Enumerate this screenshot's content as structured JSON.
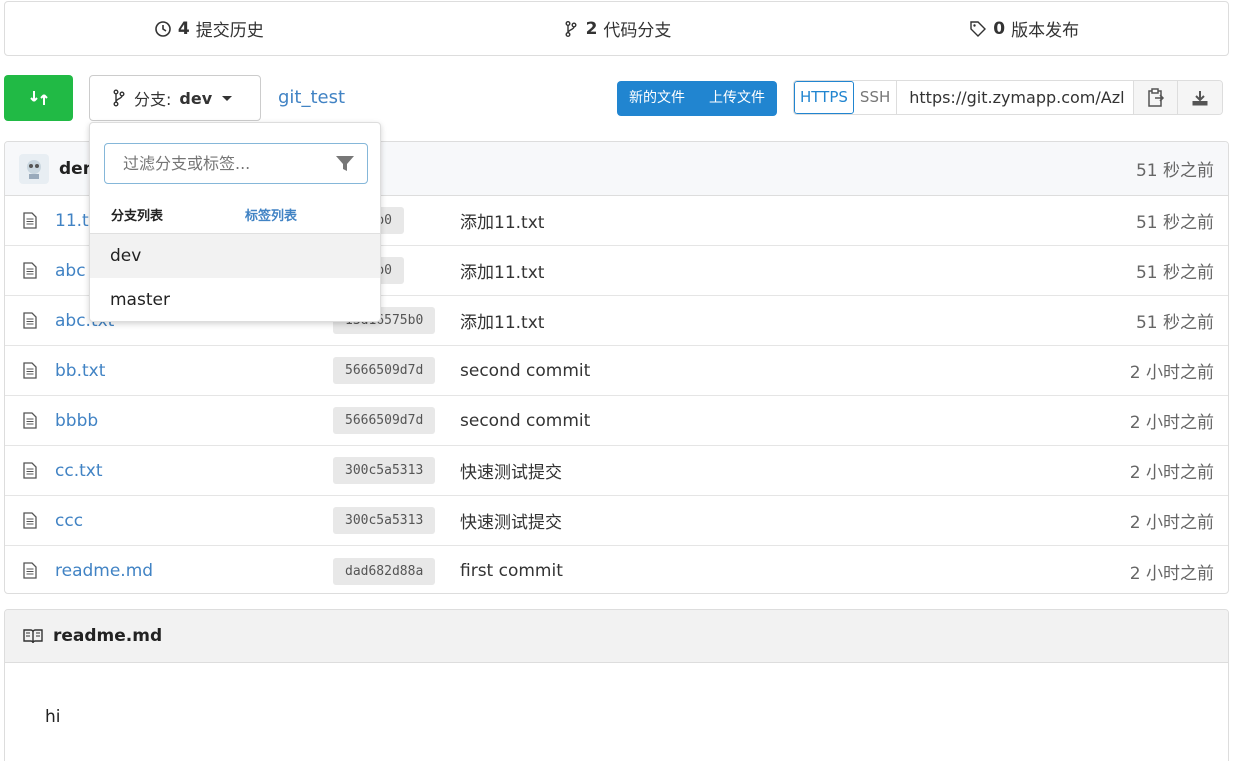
{
  "stats": {
    "commits_count": "4",
    "commits_label": "提交历史",
    "branches_count": "2",
    "branches_label": "代码分支",
    "releases_count": "0",
    "releases_label": "版本发布"
  },
  "toolbar": {
    "branch_prefix": "分支:",
    "branch_name": "dev",
    "repo_name": "git_test",
    "new_file_label": "新的文件",
    "upload_label": "上传文件",
    "https_label": "HTTPS",
    "ssh_label": "SSH",
    "clone_url": "https://git.zymapp.com/Azl"
  },
  "dropdown": {
    "filter_placeholder": "过滤分支或标签...",
    "tab_branches": "分支列表",
    "tab_tags": "标签列表",
    "options": [
      "dev",
      "master"
    ]
  },
  "latest_commit": {
    "author": "dem",
    "time": "51 秒之前"
  },
  "files": [
    {
      "name": "11.txt",
      "sha": "6575b0",
      "message": "添加11.txt",
      "time": "51 秒之前"
    },
    {
      "name": "abc",
      "sha": "6575b0",
      "message": "添加11.txt",
      "time": "51 秒之前"
    },
    {
      "name": "abc.txt",
      "sha": "13d16575b0",
      "message": "添加11.txt",
      "time": "51 秒之前"
    },
    {
      "name": "bb.txt",
      "sha": "5666509d7d",
      "message": "second commit",
      "time": "2 小时之前"
    },
    {
      "name": "bbbb",
      "sha": "5666509d7d",
      "message": "second commit",
      "time": "2 小时之前"
    },
    {
      "name": "cc.txt",
      "sha": "300c5a5313",
      "message": "快速测试提交",
      "time": "2 小时之前"
    },
    {
      "name": "ccc",
      "sha": "300c5a5313",
      "message": "快速测试提交",
      "time": "2 小时之前"
    },
    {
      "name": "readme.md",
      "sha": "dad682d88a",
      "message": "first commit",
      "time": "2 小时之前"
    }
  ],
  "readme": {
    "title": "readme.md",
    "content": "hi"
  },
  "colors": {
    "green": "#21ba45",
    "blue": "#2185d0",
    "link": "#4183c4"
  }
}
